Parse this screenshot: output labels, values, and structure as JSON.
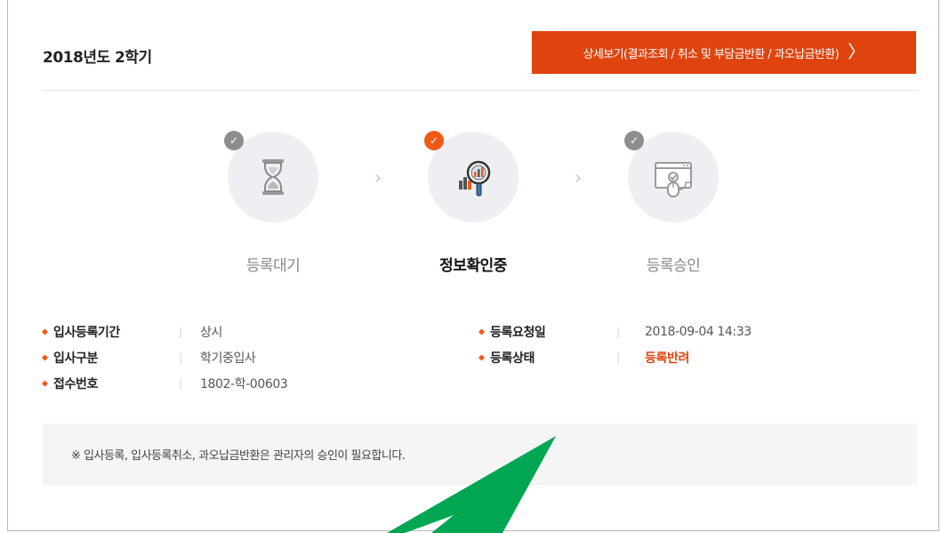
{
  "header": {
    "title": "2018년도 2학기",
    "detail_button": "상세보기(결과조회 / 취소 및 부담금반환 / 과오납금반환)",
    "detail_chevron": "〉"
  },
  "steps": [
    {
      "label": "등록대기",
      "icon": "hourglass-icon",
      "state": "done"
    },
    {
      "label": "정보확인중",
      "icon": "magnifier-chart-icon",
      "state": "current"
    },
    {
      "label": "등록승인",
      "icon": "browser-mouse-icon",
      "state": "done"
    }
  ],
  "step_arrow": "›",
  "check_mark": "✓",
  "info": {
    "left": [
      {
        "key": "입사등록기간",
        "value": "상시"
      },
      {
        "key": "입사구분",
        "value": "학기중입사"
      },
      {
        "key": "접수번호",
        "value": "1802-학-00603"
      }
    ],
    "right": [
      {
        "key": "등록요청일",
        "value": "2018-09-04 14:33"
      },
      {
        "key": "등록상태",
        "value": "등록반려"
      }
    ],
    "separator": "|"
  },
  "notice": "※ 입사등록, 입사등록취소, 과오납금반환은 관리자의 승인이 필요합니다.",
  "colors": {
    "accent": "#e0440e",
    "active_check": "#f05a14",
    "inactive_check": "#8d8d8d",
    "overlay_arrow": "#00a651"
  }
}
